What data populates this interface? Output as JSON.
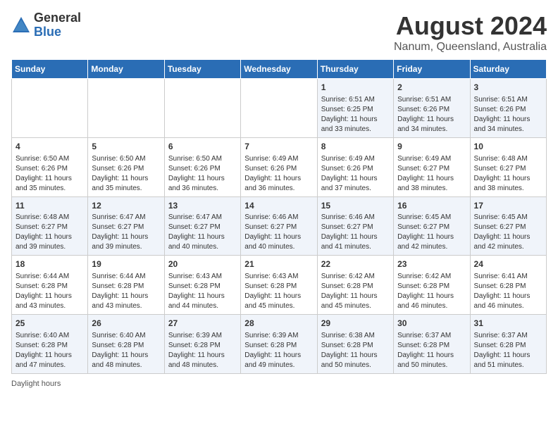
{
  "logo": {
    "general": "General",
    "blue": "Blue"
  },
  "header": {
    "month": "August 2024",
    "location": "Nanum, Queensland, Australia"
  },
  "weekdays": [
    "Sunday",
    "Monday",
    "Tuesday",
    "Wednesday",
    "Thursday",
    "Friday",
    "Saturday"
  ],
  "weeks": [
    [
      {
        "day": "",
        "info": ""
      },
      {
        "day": "",
        "info": ""
      },
      {
        "day": "",
        "info": ""
      },
      {
        "day": "",
        "info": ""
      },
      {
        "day": "1",
        "info": "Sunrise: 6:51 AM\nSunset: 6:25 PM\nDaylight: 11 hours and 33 minutes."
      },
      {
        "day": "2",
        "info": "Sunrise: 6:51 AM\nSunset: 6:26 PM\nDaylight: 11 hours and 34 minutes."
      },
      {
        "day": "3",
        "info": "Sunrise: 6:51 AM\nSunset: 6:26 PM\nDaylight: 11 hours and 34 minutes."
      }
    ],
    [
      {
        "day": "4",
        "info": "Sunrise: 6:50 AM\nSunset: 6:26 PM\nDaylight: 11 hours and 35 minutes."
      },
      {
        "day": "5",
        "info": "Sunrise: 6:50 AM\nSunset: 6:26 PM\nDaylight: 11 hours and 35 minutes."
      },
      {
        "day": "6",
        "info": "Sunrise: 6:50 AM\nSunset: 6:26 PM\nDaylight: 11 hours and 36 minutes."
      },
      {
        "day": "7",
        "info": "Sunrise: 6:49 AM\nSunset: 6:26 PM\nDaylight: 11 hours and 36 minutes."
      },
      {
        "day": "8",
        "info": "Sunrise: 6:49 AM\nSunset: 6:26 PM\nDaylight: 11 hours and 37 minutes."
      },
      {
        "day": "9",
        "info": "Sunrise: 6:49 AM\nSunset: 6:27 PM\nDaylight: 11 hours and 38 minutes."
      },
      {
        "day": "10",
        "info": "Sunrise: 6:48 AM\nSunset: 6:27 PM\nDaylight: 11 hours and 38 minutes."
      }
    ],
    [
      {
        "day": "11",
        "info": "Sunrise: 6:48 AM\nSunset: 6:27 PM\nDaylight: 11 hours and 39 minutes."
      },
      {
        "day": "12",
        "info": "Sunrise: 6:47 AM\nSunset: 6:27 PM\nDaylight: 11 hours and 39 minutes."
      },
      {
        "day": "13",
        "info": "Sunrise: 6:47 AM\nSunset: 6:27 PM\nDaylight: 11 hours and 40 minutes."
      },
      {
        "day": "14",
        "info": "Sunrise: 6:46 AM\nSunset: 6:27 PM\nDaylight: 11 hours and 40 minutes."
      },
      {
        "day": "15",
        "info": "Sunrise: 6:46 AM\nSunset: 6:27 PM\nDaylight: 11 hours and 41 minutes."
      },
      {
        "day": "16",
        "info": "Sunrise: 6:45 AM\nSunset: 6:27 PM\nDaylight: 11 hours and 42 minutes."
      },
      {
        "day": "17",
        "info": "Sunrise: 6:45 AM\nSunset: 6:27 PM\nDaylight: 11 hours and 42 minutes."
      }
    ],
    [
      {
        "day": "18",
        "info": "Sunrise: 6:44 AM\nSunset: 6:28 PM\nDaylight: 11 hours and 43 minutes."
      },
      {
        "day": "19",
        "info": "Sunrise: 6:44 AM\nSunset: 6:28 PM\nDaylight: 11 hours and 43 minutes."
      },
      {
        "day": "20",
        "info": "Sunrise: 6:43 AM\nSunset: 6:28 PM\nDaylight: 11 hours and 44 minutes."
      },
      {
        "day": "21",
        "info": "Sunrise: 6:43 AM\nSunset: 6:28 PM\nDaylight: 11 hours and 45 minutes."
      },
      {
        "day": "22",
        "info": "Sunrise: 6:42 AM\nSunset: 6:28 PM\nDaylight: 11 hours and 45 minutes."
      },
      {
        "day": "23",
        "info": "Sunrise: 6:42 AM\nSunset: 6:28 PM\nDaylight: 11 hours and 46 minutes."
      },
      {
        "day": "24",
        "info": "Sunrise: 6:41 AM\nSunset: 6:28 PM\nDaylight: 11 hours and 46 minutes."
      }
    ],
    [
      {
        "day": "25",
        "info": "Sunrise: 6:40 AM\nSunset: 6:28 PM\nDaylight: 11 hours and 47 minutes."
      },
      {
        "day": "26",
        "info": "Sunrise: 6:40 AM\nSunset: 6:28 PM\nDaylight: 11 hours and 48 minutes."
      },
      {
        "day": "27",
        "info": "Sunrise: 6:39 AM\nSunset: 6:28 PM\nDaylight: 11 hours and 48 minutes."
      },
      {
        "day": "28",
        "info": "Sunrise: 6:39 AM\nSunset: 6:28 PM\nDaylight: 11 hours and 49 minutes."
      },
      {
        "day": "29",
        "info": "Sunrise: 6:38 AM\nSunset: 6:28 PM\nDaylight: 11 hours and 50 minutes."
      },
      {
        "day": "30",
        "info": "Sunrise: 6:37 AM\nSunset: 6:28 PM\nDaylight: 11 hours and 50 minutes."
      },
      {
        "day": "31",
        "info": "Sunrise: 6:37 AM\nSunset: 6:28 PM\nDaylight: 11 hours and 51 minutes."
      }
    ]
  ],
  "legend": {
    "daylight_label": "Daylight hours"
  }
}
